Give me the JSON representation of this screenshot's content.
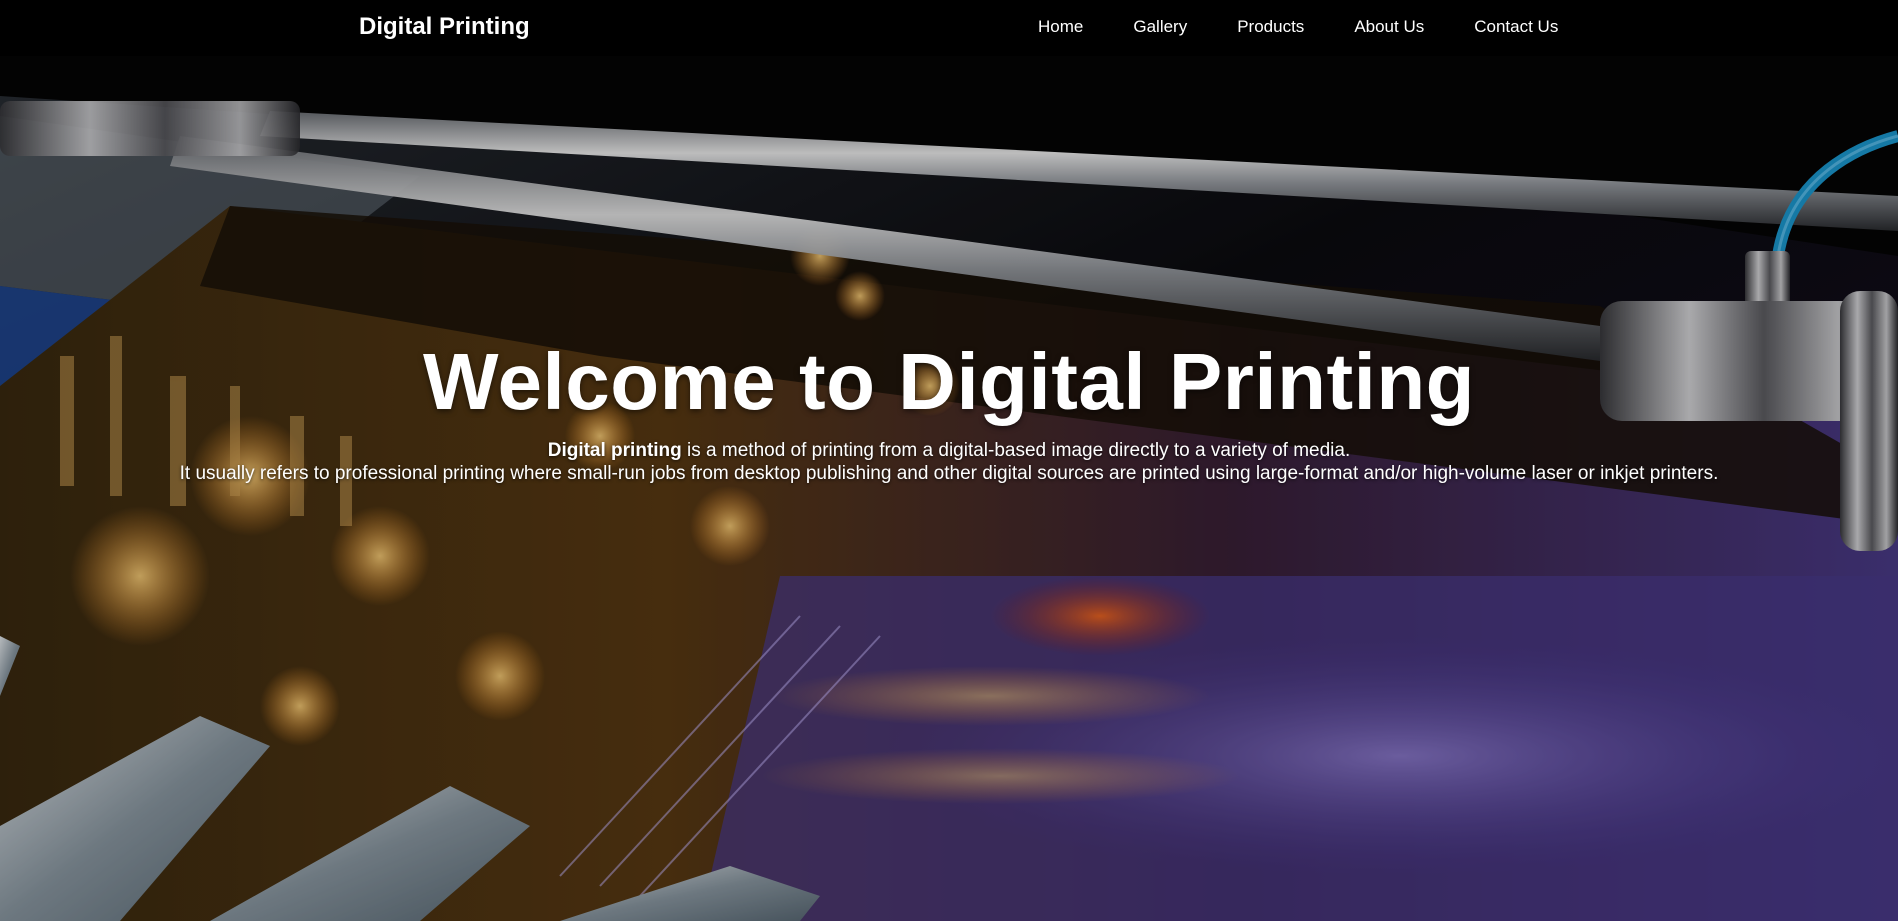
{
  "navbar": {
    "brand": "Digital Printing",
    "links": [
      {
        "label": "Home"
      },
      {
        "label": "Gallery"
      },
      {
        "label": "Products"
      },
      {
        "label": "About Us"
      },
      {
        "label": "Contact Us"
      }
    ]
  },
  "hero": {
    "title": "Welcome to Digital Printing",
    "description": {
      "line1_bold": "Digital printing",
      "line1_rest": " is a method of printing from a digital-based image directly to a variety of media.",
      "line2": "It usually refers to professional printing where small-run jobs from desktop publishing and other digital sources are printed using large-format and/or high-volume laser or inkjet printers."
    },
    "background_image": "large-format printer printing a night cityscape photo with rollers, print head and blue cable"
  },
  "colors": {
    "navbar_bg": "#000000",
    "text": "#ffffff"
  }
}
